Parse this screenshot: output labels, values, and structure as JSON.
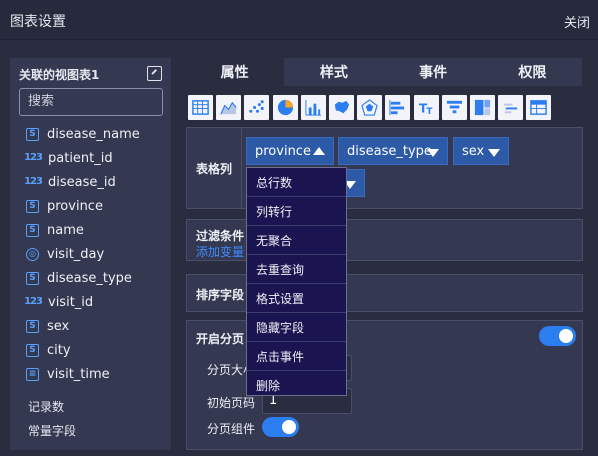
{
  "dialog": {
    "title": "图表设置",
    "close_label": "关闭"
  },
  "left_panel": {
    "header": "关联的视图表1",
    "search_placeholder": "搜索",
    "fields": [
      {
        "type_icon": "S",
        "icon_name": "string-type-icon",
        "name": "disease_name"
      },
      {
        "type_icon": "123",
        "icon_name": "number-type-icon",
        "name": "patient_id"
      },
      {
        "type_icon": "123",
        "icon_name": "number-type-icon",
        "name": "disease_id"
      },
      {
        "type_icon": "S",
        "icon_name": "string-type-icon",
        "name": "province"
      },
      {
        "type_icon": "S",
        "icon_name": "string-type-icon",
        "name": "name"
      },
      {
        "type_icon": "◎",
        "icon_name": "date-type-icon",
        "name": "visit_day"
      },
      {
        "type_icon": "S",
        "icon_name": "string-type-icon",
        "name": "disease_type"
      },
      {
        "type_icon": "123",
        "icon_name": "number-type-icon",
        "name": "visit_id"
      },
      {
        "type_icon": "S",
        "icon_name": "string-type-icon",
        "name": "sex"
      },
      {
        "type_icon": "S",
        "icon_name": "string-type-icon",
        "name": "city"
      },
      {
        "type_icon": "≡",
        "icon_name": "datetime-type-icon",
        "name": "visit_time"
      }
    ],
    "record_count": "记录数",
    "constant_field": "常量字段"
  },
  "tabs": [
    "属性",
    "样式",
    "事件",
    "权限"
  ],
  "chart_types": [
    "table-chart-icon",
    "area-chart-icon",
    "scatter-chart-icon",
    "pie-chart-icon",
    "bar-chart-icon",
    "map-chart-icon",
    "radar-chart-icon",
    "horizontal-bar-chart-icon",
    "text-chart-icon",
    "funnel-chart-icon",
    "treemap-chart-icon",
    "wordcloud-chart-icon",
    "crosstab-chart-icon"
  ],
  "columns_section": {
    "label": "表格列",
    "chips": [
      "province",
      "disease_type",
      "sex"
    ]
  },
  "filter_section": {
    "label": "过滤条件",
    "link": "添加变量"
  },
  "sort_section": {
    "label": "排序字段"
  },
  "paging_section": {
    "enable_label": "开启分页",
    "page_size_label": "分页大小",
    "initial_page_label": "初始页码",
    "initial_page_value": "1",
    "page_component_label": "分页组件"
  },
  "context_menu": [
    "总行数",
    "列转行",
    "无聚合",
    "去重查询",
    "格式设置",
    "隐藏字段",
    "点击事件",
    "删除"
  ]
}
